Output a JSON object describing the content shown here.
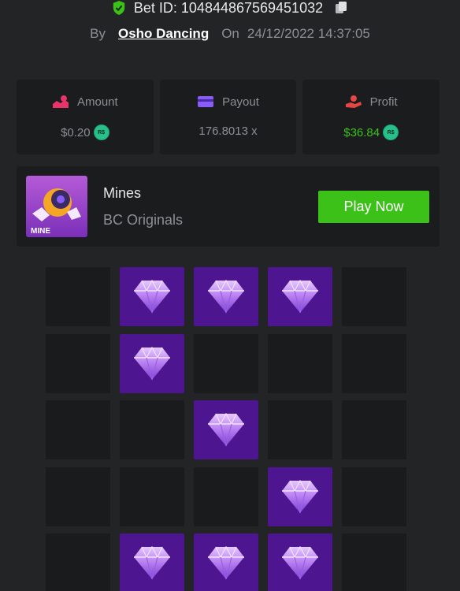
{
  "header": {
    "bet_id_label": "Bet ID: 104844867569451032",
    "by_label": "By",
    "username": "Osho Dancing",
    "on_label": "On",
    "datetime": "24/12/2022 14:37:05"
  },
  "stats": {
    "amount": {
      "label": "Amount",
      "value": "$0.20",
      "coin": "R$"
    },
    "payout": {
      "label": "Payout",
      "value": "176.8013 x"
    },
    "profit": {
      "label": "Profit",
      "value": "$36.84",
      "coin": "R$"
    }
  },
  "game": {
    "name": "Mines",
    "provider": "BC Originals",
    "thumb_label": "MINE",
    "play_label": "Play Now"
  },
  "board": {
    "rows": 5,
    "cols": 5,
    "cells": [
      [
        "empty",
        "gem",
        "gem",
        "gem",
        "empty"
      ],
      [
        "empty",
        "gem",
        "empty",
        "empty",
        "empty"
      ],
      [
        "empty",
        "empty",
        "gem",
        "empty",
        "empty"
      ],
      [
        "empty",
        "empty",
        "empty",
        "gem",
        "empty"
      ],
      [
        "empty",
        "gem",
        "gem",
        "gem",
        "empty"
      ]
    ]
  },
  "colors": {
    "background": "#232426",
    "card": "#1b1c1e",
    "accent_green": "#3bc117",
    "gem_tile": "#4d158f",
    "amount_icon": "#e8336b",
    "payout_icon": "#8a5cf6",
    "profit_icon": "#e84545"
  },
  "icons": {
    "verified": "shield-check-icon",
    "copy": "copy-icon",
    "amount": "bet-amount-icon",
    "payout": "payout-card-icon",
    "profit": "profit-hand-icon",
    "gem": "diamond-icon"
  }
}
